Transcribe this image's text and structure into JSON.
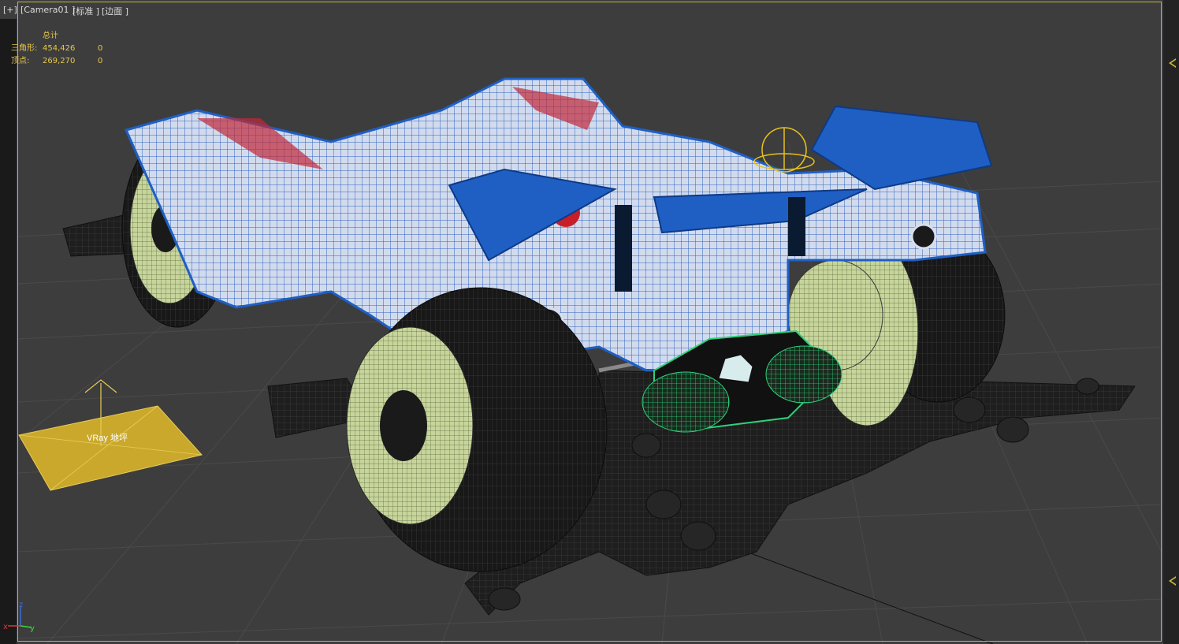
{
  "viewport": {
    "label_plus": "[+]",
    "label_camera": "[Camera01 ]",
    "label_shading": "[标准 ]",
    "label_mode": "[边面 ]"
  },
  "stats": {
    "header": "总计",
    "triangles_label": "三角形:",
    "triangles_total": "454,426",
    "triangles_selected": "0",
    "vertices_label": "顶点:",
    "vertices_total": "269,270",
    "vertices_selected": "0"
  },
  "scene": {
    "vray_plane_label": "VRay 地坪"
  },
  "axis_tripod": {
    "z": "z",
    "x": "x",
    "y": "y"
  },
  "colors": {
    "background": "#3d3d3d",
    "grid": "#4a4a4a",
    "frame_highlight": "#c8b43a",
    "stats_text": "#e8c64a",
    "body_blue": "#1f5fc4",
    "body_white": "#d6deef",
    "tire_dark": "#1b1b1b",
    "rim_green": "#b8c98a",
    "motor_green": "#22c06a",
    "vray_plane": "#c9a82c"
  },
  "icons": [
    "view-marker-icon",
    "axis-tripod-icon",
    "vray-plane-icon",
    "camera-target-icon"
  ]
}
